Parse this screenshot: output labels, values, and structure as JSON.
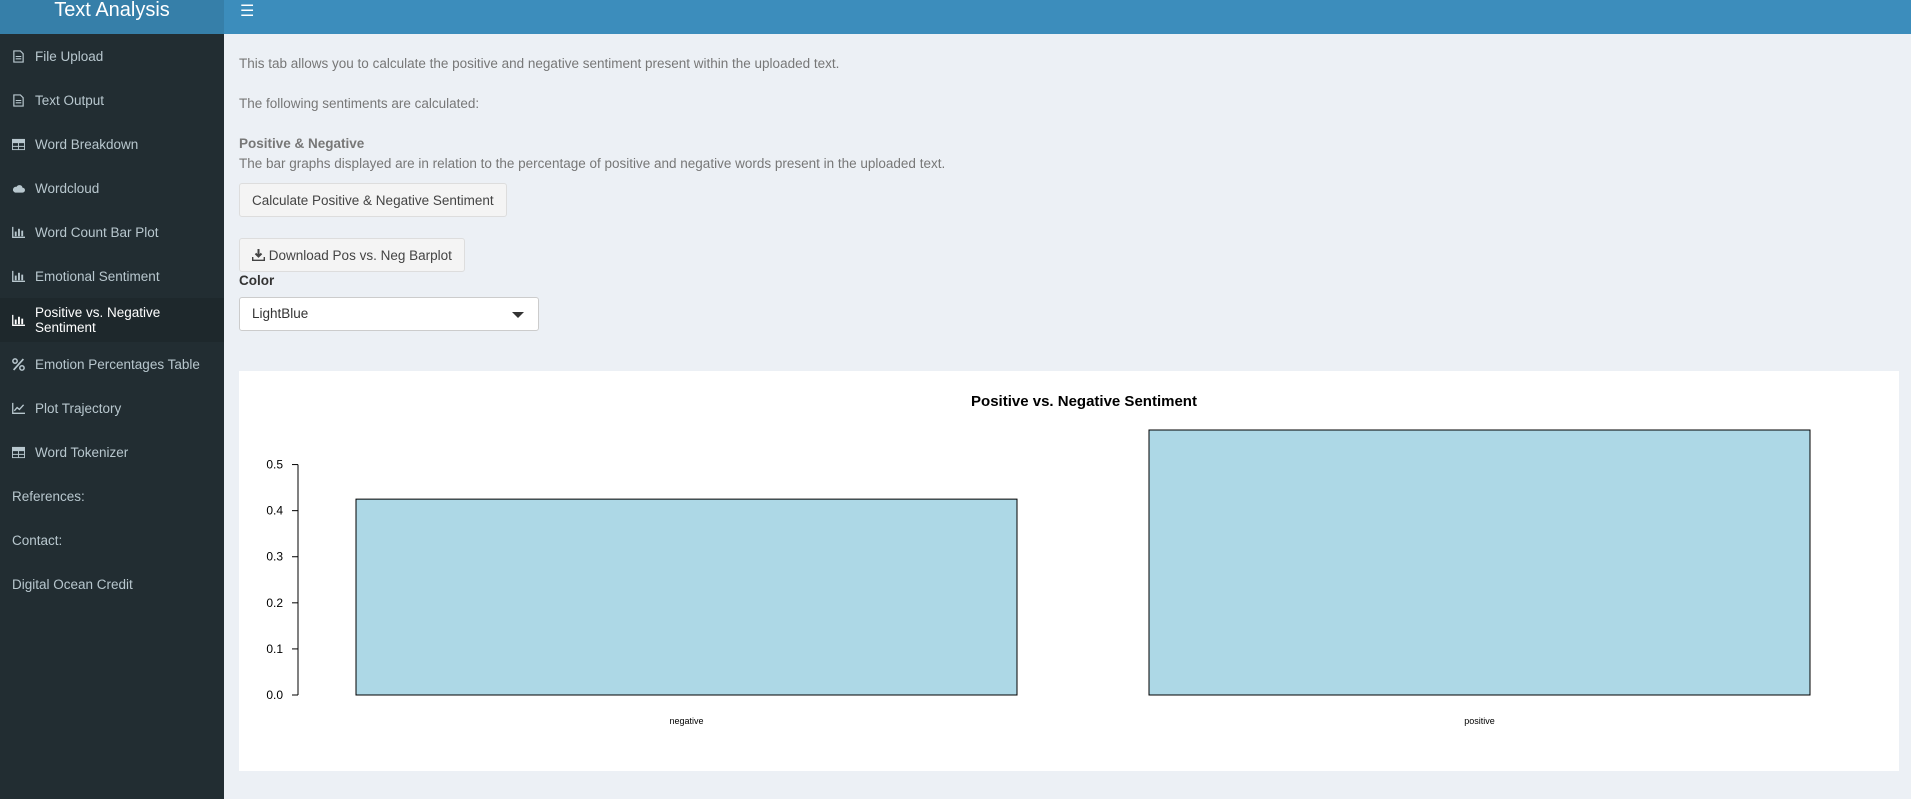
{
  "header": {
    "app_title": "Text Analysis",
    "menu_icon": "hamburger-icon"
  },
  "sidebar": {
    "items": [
      {
        "label": "File Upload",
        "icon": "file-icon"
      },
      {
        "label": "Text Output",
        "icon": "file-icon"
      },
      {
        "label": "Word Breakdown",
        "icon": "table-icon"
      },
      {
        "label": "Wordcloud",
        "icon": "cloud-icon"
      },
      {
        "label": "Word Count Bar Plot",
        "icon": "bar-chart-icon"
      },
      {
        "label": "Emotional Sentiment",
        "icon": "bar-chart-icon"
      },
      {
        "label": "Positive vs. Negative Sentiment",
        "icon": "bar-chart-icon",
        "active": true
      },
      {
        "label": "Emotion Percentages Table",
        "icon": "percent-icon"
      },
      {
        "label": "Plot Trajectory",
        "icon": "line-chart-icon"
      },
      {
        "label": "Word Tokenizer",
        "icon": "table-icon"
      },
      {
        "label": "References:"
      },
      {
        "label": "Contact:"
      },
      {
        "label": "Digital Ocean Credit"
      }
    ]
  },
  "main": {
    "intro": "This tab allows you to calculate the positive and negative sentiment present within the uploaded text.",
    "following": "The following sentiments are calculated:",
    "section_title": "Positive & Negative",
    "section_desc": "The bar graphs displayed are in relation to the percentage of positive and negative words present in the uploaded text.",
    "calc_button": "Calculate Positive & Negative Sentiment",
    "download_button": "Download Pos vs. Neg Barplot",
    "color_label": "Color",
    "color_value": "LightBlue"
  },
  "chart_data": {
    "type": "bar",
    "title": "Positive vs. Negative Sentiment",
    "categories": [
      "negative",
      "positive"
    ],
    "values": [
      0.425,
      0.575
    ],
    "yticks": [
      "0.0",
      "0.1",
      "0.2",
      "0.3",
      "0.4",
      "0.5"
    ],
    "ylim": [
      0,
      0.575
    ],
    "bar_color": "#add8e6",
    "grid": false
  }
}
